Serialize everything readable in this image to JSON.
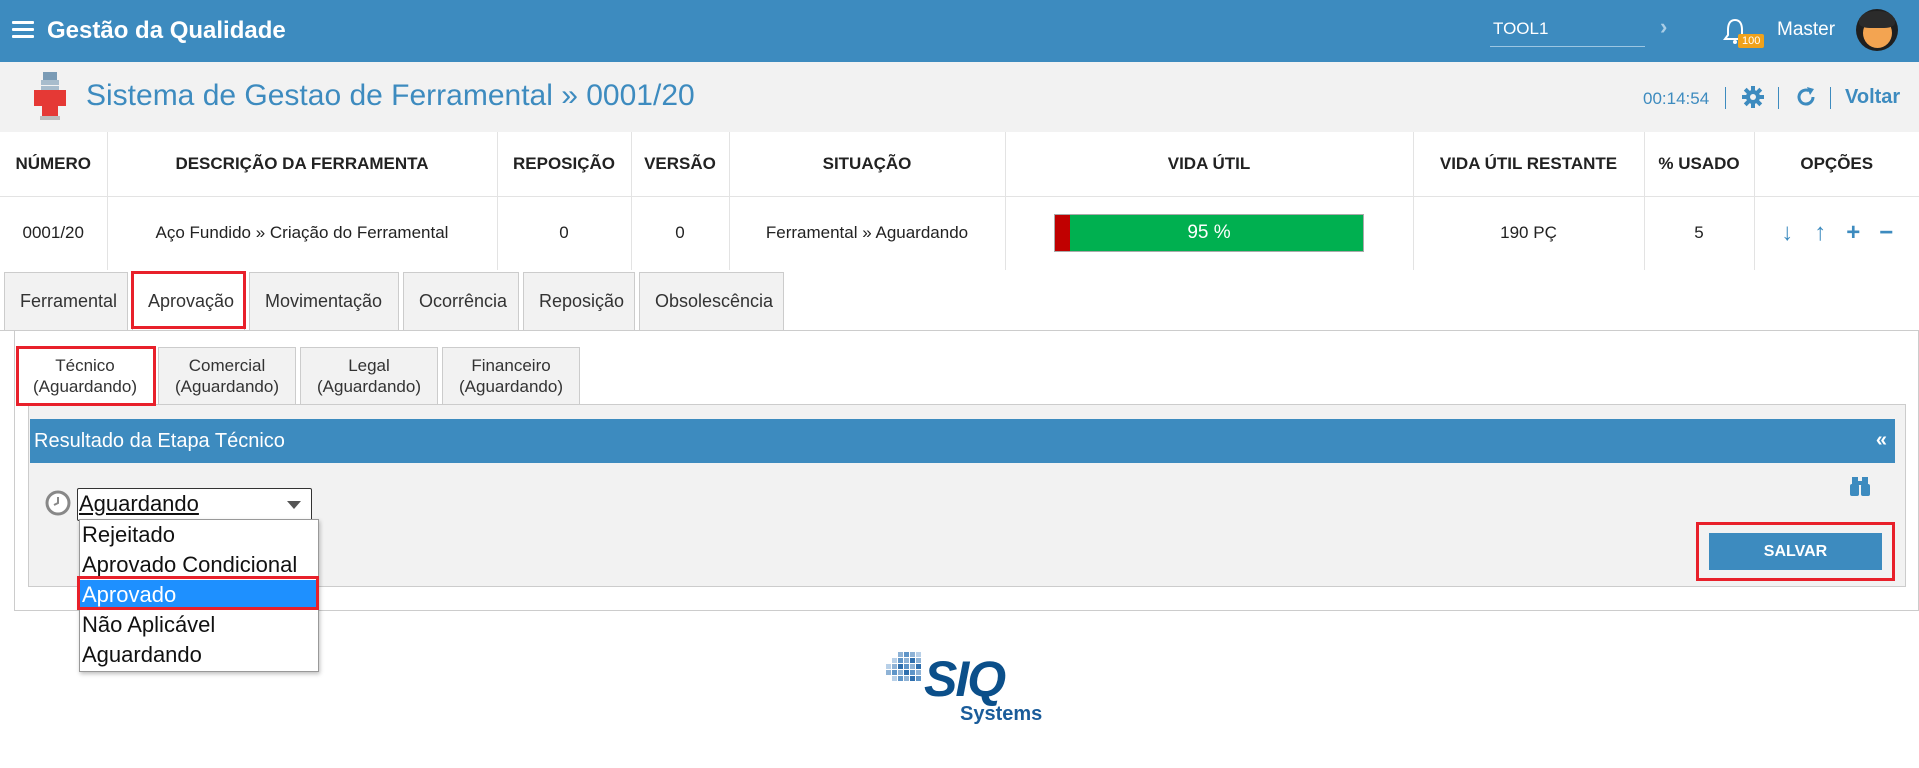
{
  "topbar": {
    "app_title": "Gestão da Qualidade",
    "search_value": "TOOL1",
    "notification_count": "100",
    "user_name": "Master"
  },
  "header": {
    "title": "Sistema de Gestao de Ferramental » 0001/20",
    "timer": "00:14:54",
    "back_label": "Voltar"
  },
  "table": {
    "headers": [
      "NÚMERO",
      "DESCRIÇÃO DA FERRAMENTA",
      "REPOSIÇÃO",
      "VERSÃO",
      "SITUAÇÃO",
      "VIDA ÚTIL",
      "VIDA ÚTIL RESTANTE",
      "% USADO",
      "OPÇÕES"
    ],
    "row": {
      "numero": "0001/20",
      "descricao": "Aço Fundido » Criação do Ferramental",
      "reposicao": "0",
      "versao": "0",
      "situacao": "Ferramental » Aguardando",
      "vida_util_label": "95 %",
      "vida_util_percent": 95,
      "vida_util_restante": "190 PÇ",
      "usado": "5"
    },
    "options_icons": [
      "arrow-down-icon",
      "arrow-up-icon",
      "plus-icon",
      "minus-icon"
    ]
  },
  "main_tabs": [
    "Ferramental",
    "Aprovação",
    "Movimentação",
    "Ocorrência",
    "Reposição",
    "Obsolescência"
  ],
  "main_tab_active": "Aprovação",
  "sub_tabs": [
    {
      "name": "Técnico",
      "status": "(Aguardando)"
    },
    {
      "name": "Comercial",
      "status": "(Aguardando)"
    },
    {
      "name": "Legal",
      "status": "(Aguardando)"
    },
    {
      "name": "Financeiro",
      "status": "(Aguardando)"
    }
  ],
  "section": {
    "title": "Resultado da Etapa Técnico",
    "collapse_symbol": "«"
  },
  "result_select": {
    "value": "Aguardando",
    "options": [
      "Rejeitado",
      "Aprovado Condicional",
      "Aprovado",
      "Não Aplicável",
      "Aguardando"
    ],
    "highlighted_option": "Aprovado"
  },
  "save_label": "SALVAR",
  "logo": {
    "text": "SIQ",
    "subtext": "Systems"
  },
  "colors": {
    "primary": "#3d8bbf",
    "header_bg": "#f2f2f2",
    "life_used": "#c00000",
    "life_remaining": "#00b050",
    "highlight": "#e8202a",
    "badge": "#f0a21b",
    "option_selected": "#1e90ff"
  }
}
